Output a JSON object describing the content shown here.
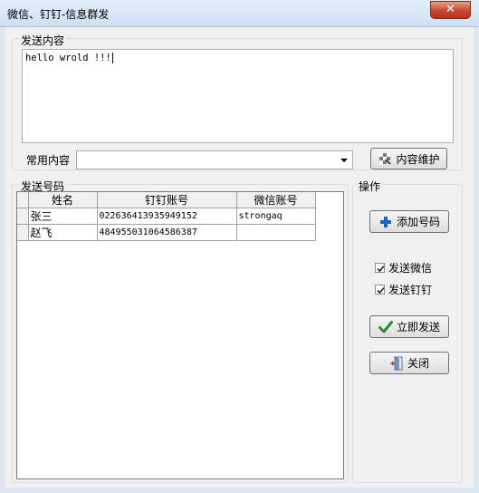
{
  "window": {
    "title": "微信、钉钉-信息群发",
    "close_glyph": "✕"
  },
  "send_content": {
    "group_label": "发送内容",
    "text": "hello wrold !!!"
  },
  "common": {
    "label": "常用内容",
    "selected": "",
    "maintain_button": "内容维护"
  },
  "numbers": {
    "group_label": "发送号码",
    "columns": [
      "姓名",
      "钉钉账号",
      "微信账号"
    ],
    "rows": [
      {
        "name": "张三",
        "dingtalk": "022636413935949152",
        "wechat": "strongaq"
      },
      {
        "name": "赵飞",
        "dingtalk": "484955031064586387",
        "wechat": ""
      }
    ]
  },
  "actions": {
    "group_label": "操作",
    "add_button": "添加号码",
    "send_wechat": {
      "label": "发送微信",
      "checked": true
    },
    "send_dingtalk": {
      "label": "发送钉钉",
      "checked": true
    },
    "send_now_button": "立即发送",
    "close_button": "关闭"
  }
}
